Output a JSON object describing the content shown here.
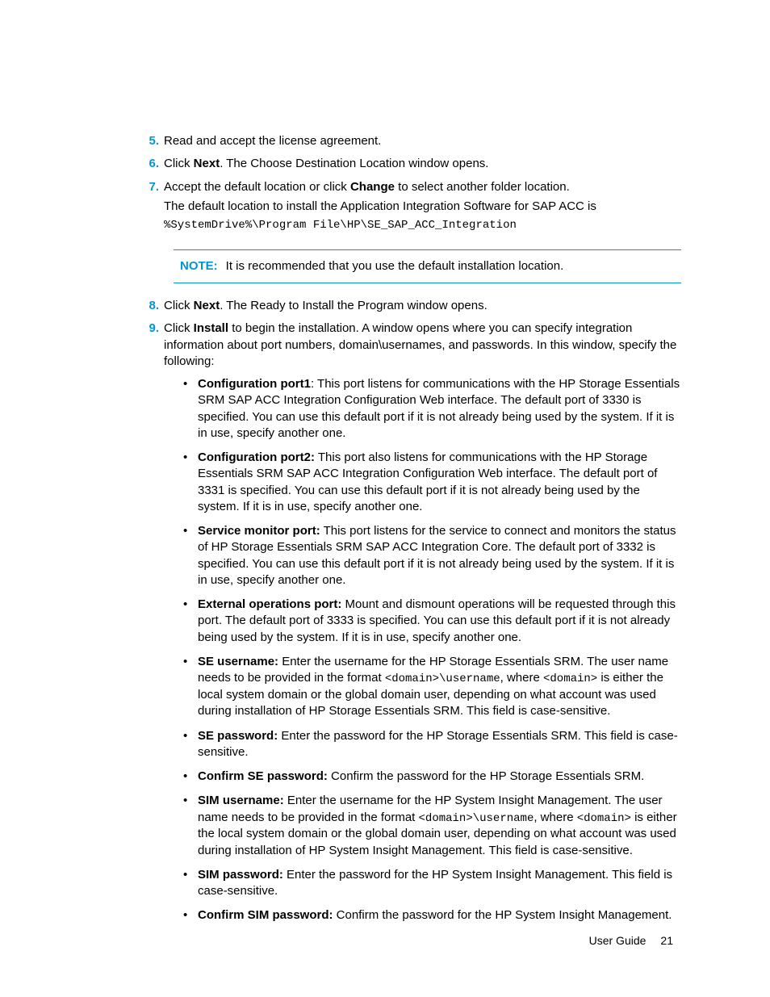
{
  "steps": {
    "s5": "Read and accept the license agreement.",
    "s6_a": "Click ",
    "s6_b": "Next",
    "s6_c": ". The Choose Destination Location window opens.",
    "s7_a": "Accept the default location or click ",
    "s7_b": "Change",
    "s7_c": " to select another folder location.",
    "s7_p2": "The default location to install the Application Integration Software for SAP ACC is ",
    "s7_code": "%SystemDrive%\\Program File\\HP\\SE_SAP_ACC_Integration",
    "s8_a": "Click ",
    "s8_b": "Next",
    "s8_c": ". The Ready to Install the Program window opens.",
    "s9_a": "Click ",
    "s9_b": "Install",
    "s9_c": " to begin the installation. A window opens where you can specify integration information about port numbers, domain\\usernames, and passwords. In this window, specify the following:"
  },
  "note": {
    "label": "NOTE:",
    "text": "It is recommended that you use the default installation location."
  },
  "bullets": {
    "b1_t": "Configuration port1",
    "b1_r": ": This port listens for communications with the HP Storage Essentials SRM SAP ACC Integration Configuration Web interface. The default port of 3330 is specified. You can use this default port if it is not already being used by the system. If it is in use, specify another one.",
    "b2_t": "Configuration port2:",
    "b2_r": " This port also listens for communications with the HP Storage Essentials SRM SAP ACC Integration Configuration Web interface. The default port of 3331 is specified. You can use this default port if it is not already being used by the system. If it is in use, specify another one.",
    "b3_t": "Service monitor port:",
    "b3_r": " This port listens for the service to connect and monitors the status of HP Storage Essentials SRM SAP ACC Integration Core. The default port of 3332 is specified. You can use this default port if it is not already being used by the system. If it is in use, specify another one.",
    "b4_t": "External operations port:",
    "b4_r": " Mount and dismount operations will be requested through this port. The default port of 3333 is specified. You can use this default port if it is not already being used by the system. If it is in use, specify another one.",
    "b5_t": "SE username:",
    "b5_r1": " Enter the username for the HP Storage Essentials SRM. The user name needs to be provided in the format ",
    "b5_c1": "<domain>\\username",
    "b5_r2": ", where ",
    "b5_c2": "<domain>",
    "b5_r3": " is either the local system domain or the global domain user, depending on what account was used during installation of HP Storage Essentials SRM. This field is case-sensitive.",
    "b6_t": "SE password:",
    "b6_r": " Enter the password for the HP Storage Essentials SRM. This field is case-sensitive.",
    "b7_t": "Confirm SE password:",
    "b7_r": " Confirm the password for the HP Storage Essentials SRM.",
    "b8_t": "SIM username:",
    "b8_r1": " Enter the username for the HP System Insight Management. The user name needs to be provided in the format ",
    "b8_c1": "<domain>\\username",
    "b8_r2": ", where ",
    "b8_c2": "<domain>",
    "b8_r3": " is either the local system domain or the global domain user, depending on what account was used during installation of HP System Insight Management. This field is case-sensitive.",
    "b9_t": "SIM password:",
    "b9_r": " Enter the password for the HP System Insight Management. This field is case-sensitive.",
    "b10_t": "Confirm SIM password:",
    "b10_r": " Confirm the password for the HP System Insight Management."
  },
  "footer": {
    "label": "User Guide",
    "page": "21"
  }
}
